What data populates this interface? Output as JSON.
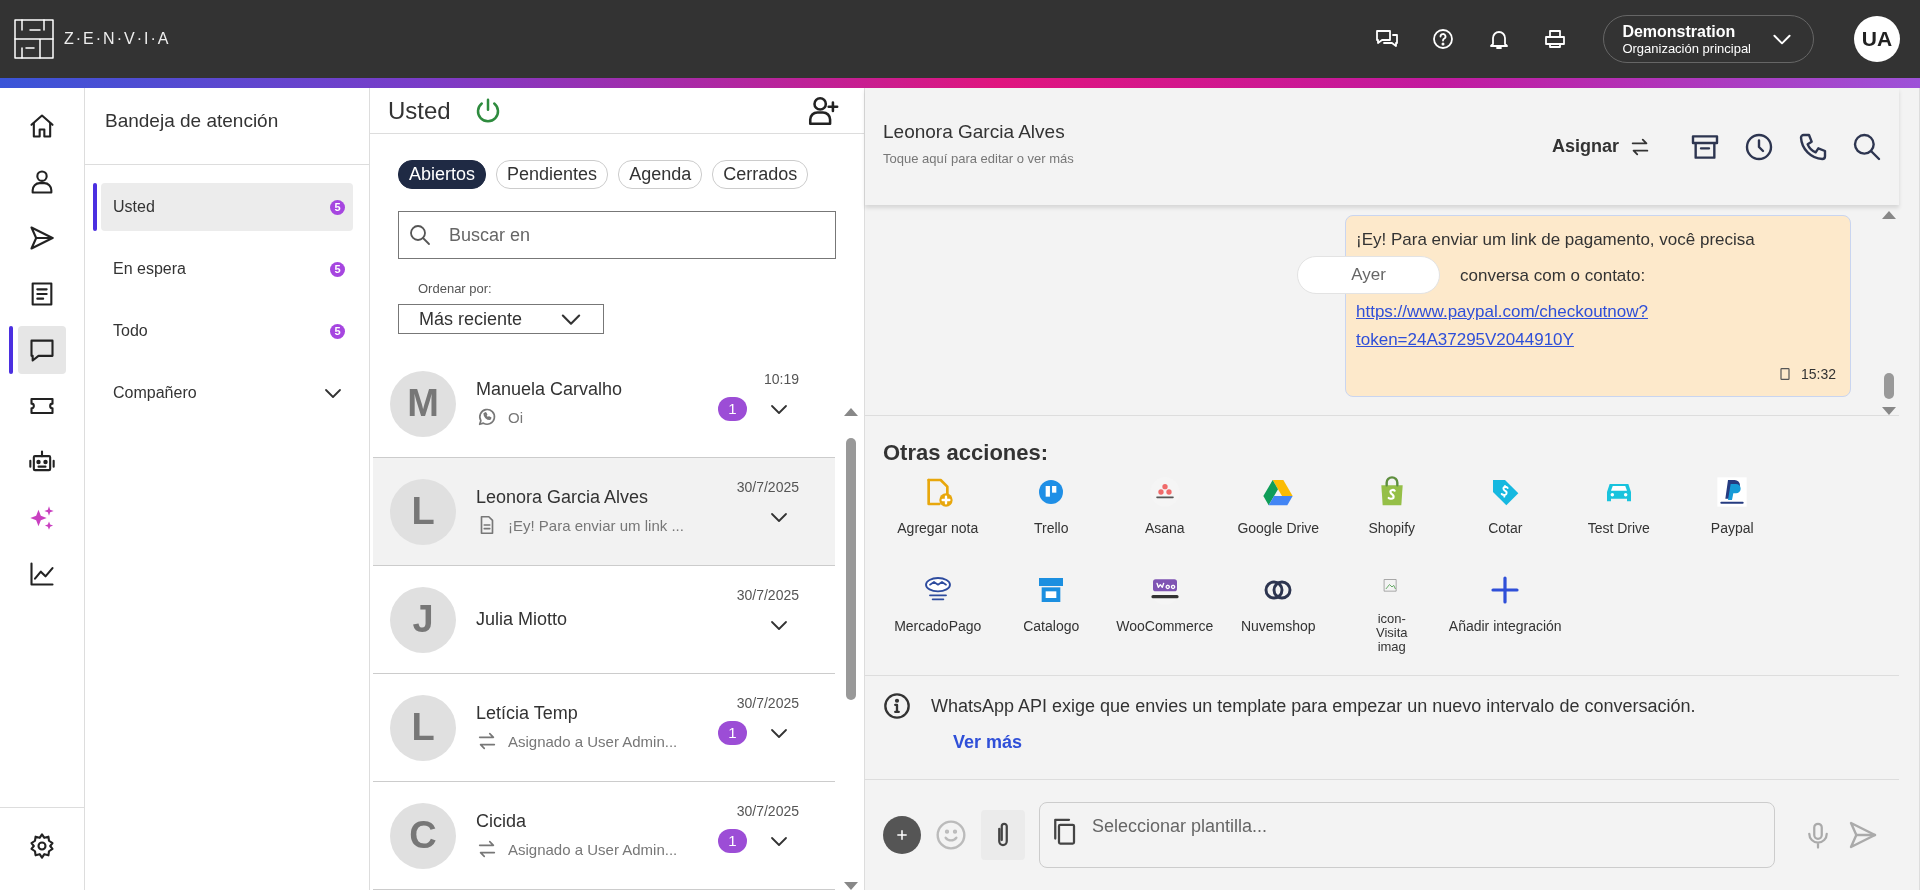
{
  "header": {
    "logo": "Z·E·N·V·I·A",
    "org_name": "Demonstration",
    "org_sub": "Organización principal",
    "avatar": "UA"
  },
  "nav": {
    "items": [
      {
        "selected": false
      },
      {
        "selected": false
      },
      {
        "selected": false
      },
      {
        "selected": false
      },
      {
        "selected": true
      },
      {
        "selected": false
      },
      {
        "selected": false
      },
      {
        "selected": false
      },
      {
        "selected": false
      }
    ],
    "settings": {
      "selected": false
    }
  },
  "inbox": {
    "title": "Bandeja de atención",
    "items": [
      {
        "kind": "filter",
        "label": "Usted",
        "count": "5",
        "selected": true
      },
      {
        "kind": "filter",
        "label": "En espera",
        "count": "5",
        "selected": false
      },
      {
        "kind": "filter",
        "label": "Todo",
        "count": "5",
        "selected": false
      },
      {
        "kind": "group",
        "label": "Compañero",
        "expanded": false
      }
    ]
  },
  "conversations": {
    "title": "Usted",
    "online": true,
    "tabs": [
      {
        "label": "Abiertos",
        "selected": true
      },
      {
        "label": "Pendientes",
        "selected": false
      },
      {
        "label": "Agenda",
        "selected": false
      },
      {
        "label": "Cerrados",
        "selected": false
      }
    ],
    "search": {
      "placeholder": "Buscar en"
    },
    "sort_label": "Ordenar por:",
    "sort_value": "Más reciente",
    "items": [
      {
        "initial": "M",
        "name": "Manuela Carvalho",
        "kind": "whatsapp",
        "preview": "Oi",
        "time": "10:19",
        "unread": "1",
        "selected": false
      },
      {
        "initial": "L",
        "name": "Leonora Garcia Alves",
        "kind": "note",
        "preview": "¡Ey! Para enviar um link ...",
        "time": "30/7/2025",
        "selected": true
      },
      {
        "initial": "J",
        "name": "Julia Miotto",
        "kind": "plain",
        "time": "30/7/2025",
        "selected": false
      },
      {
        "initial": "L",
        "name": "Letícia Temp",
        "kind": "assignment",
        "preview": "Asignado a User Admin...",
        "time": "30/7/2025",
        "unread": "1",
        "selected": false
      },
      {
        "initial": "C",
        "name": "Cicida",
        "kind": "assignment",
        "preview": "Asignado a User Admin...",
        "time": "30/7/2025",
        "unread": "1",
        "selected": false
      }
    ]
  },
  "chat": {
    "contact": "Leonora Garcia Alves",
    "hint": "Toque aquí para editar o ver más",
    "assign": "Asignar",
    "message": {
      "line_1": "¡Ey! Para enviar um link de pagamento, você precisa",
      "line_2": "conversa com o contato:",
      "link": "https://www.paypal.com/checkoutnow?token=24A37295V2044910Y",
      "time": "15:32"
    },
    "date_chip": "Ayer",
    "actions_title": "Otras acciones:",
    "actions": [
      "Agregar nota",
      "Trello",
      "Asana",
      "Google Drive",
      "Shopify",
      "Cotar",
      "Test Drive",
      "Paypal",
      "MercadoPago",
      "Catalogo",
      "WooCommerce",
      "Nuvemshop",
      "icon-Visita imag",
      "Añadir integración"
    ],
    "notice": "WhatsApp API exige que envies un template para empezar un nuevo intervalo de conversación.",
    "notice_link": "Ver más",
    "composer": {
      "placeholder": "Seleccionar plantilla..."
    }
  }
}
